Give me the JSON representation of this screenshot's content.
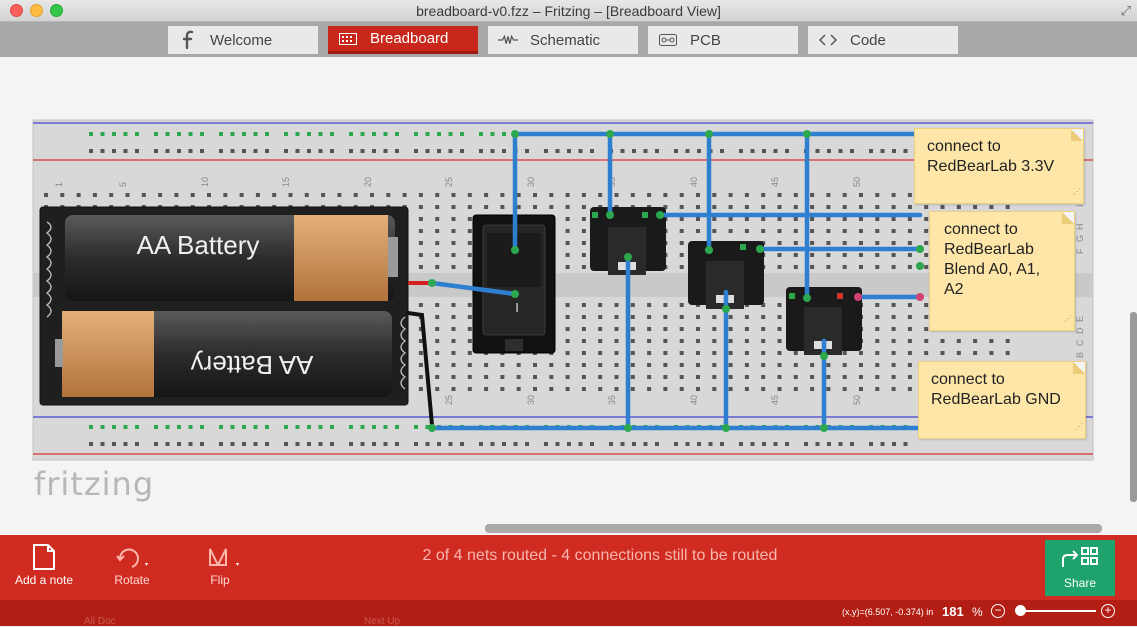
{
  "window": {
    "title": "breadboard-v0.fzz – Fritzing – [Breadboard View]"
  },
  "tabs": [
    {
      "label": "Welcome",
      "icon": "fritzing-f-icon",
      "active": false
    },
    {
      "label": "Breadboard",
      "icon": "breadboard-icon",
      "active": true
    },
    {
      "label": "Schematic",
      "icon": "resistor-icon",
      "active": false
    },
    {
      "label": "PCB",
      "icon": "pcb-icon",
      "active": false
    },
    {
      "label": "Code",
      "icon": "code-brackets-icon",
      "active": false
    }
  ],
  "canvas": {
    "logo": "fritzing",
    "battery_labels": [
      "AA Battery",
      "AA Battery"
    ],
    "switch_label": "I",
    "column_numbers_top": [
      "1",
      "5",
      "10",
      "15",
      "20",
      "25",
      "30",
      "35",
      "40",
      "45",
      "50"
    ],
    "column_numbers_bottom": [
      "25",
      "30",
      "35",
      "40",
      "45",
      "50"
    ],
    "row_letters_right": [
      "J",
      "I",
      "H",
      "G",
      "F",
      "E",
      "D",
      "C",
      "B"
    ],
    "notes": [
      {
        "text": "connect to RedBearLab 3.3V"
      },
      {
        "text": "connect to RedBearLab Blend A0, A1, A2"
      },
      {
        "text": "connect to RedBearLab GND"
      }
    ]
  },
  "toolbar": {
    "add_note": "Add a note",
    "rotate": "Rotate",
    "flip": "Flip",
    "status": "2 of 4 nets routed - 4 connections still to be routed",
    "share": "Share"
  },
  "statusbar": {
    "coords": "(x,y)=(6.507, -0.374) in",
    "zoom": "181",
    "zoom_unit": "%",
    "ghost_left": "All Doc",
    "ghost_right": "Next Up"
  },
  "colors": {
    "accent_red": "#d02b20",
    "share_green": "#1ea36c",
    "wire_blue": "#2f7fd0",
    "note_yellow": "#fde6a8"
  }
}
